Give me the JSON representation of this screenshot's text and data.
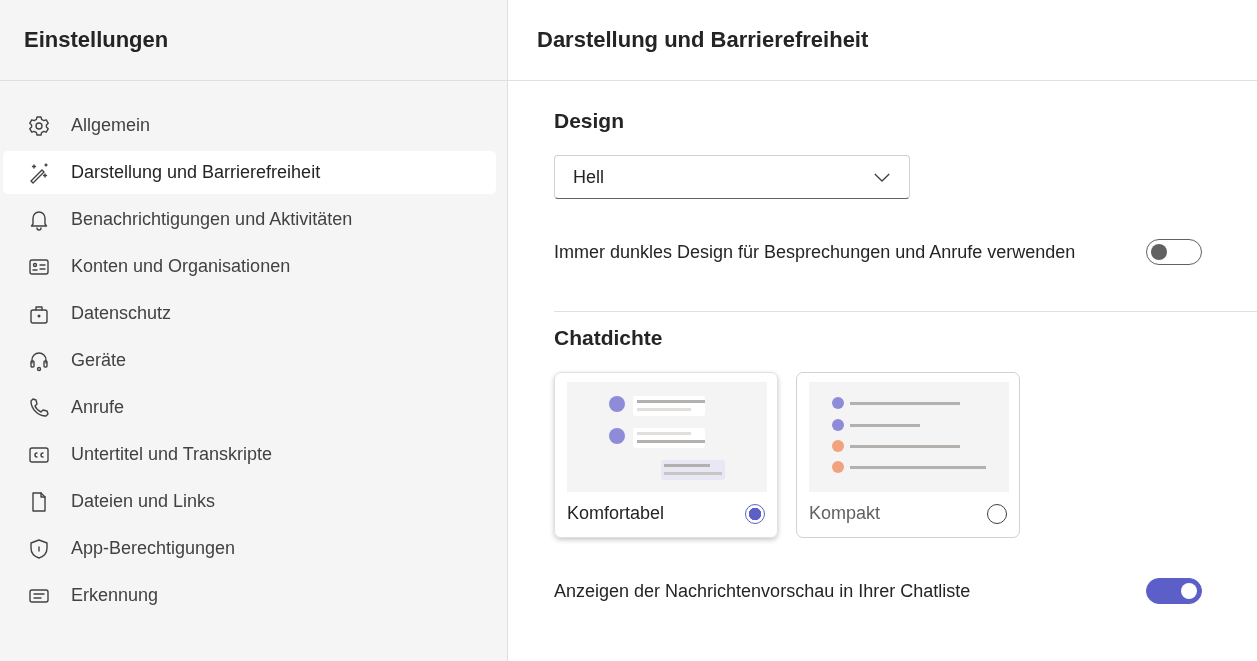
{
  "sidebar": {
    "title": "Einstellungen",
    "items": [
      {
        "label": "Allgemein",
        "selected": false
      },
      {
        "label": "Darstellung und Barrierefreiheit",
        "selected": true
      },
      {
        "label": "Benachrichtigungen und Aktivitäten",
        "selected": false
      },
      {
        "label": "Konten und Organisationen",
        "selected": false
      },
      {
        "label": "Datenschutz",
        "selected": false
      },
      {
        "label": "Geräte",
        "selected": false
      },
      {
        "label": "Anrufe",
        "selected": false
      },
      {
        "label": "Untertitel und Transkripte",
        "selected": false
      },
      {
        "label": "Dateien und Links",
        "selected": false
      },
      {
        "label": "App-Berechtigungen",
        "selected": false
      },
      {
        "label": "Erkennung",
        "selected": false
      }
    ]
  },
  "page": {
    "title": "Darstellung und Barrierefreiheit",
    "design": {
      "heading": "Design",
      "dropdown_value": "Hell",
      "toggle": {
        "label": "Immer dunkles Design für Besprechungen und Anrufe verwenden",
        "on": false
      }
    },
    "chat_density": {
      "heading": "Chatdichte",
      "options": [
        {
          "label": "Komfortabel",
          "kind": "comfortable",
          "selected": true
        },
        {
          "label": "Kompakt",
          "kind": "compact",
          "selected": false
        }
      ],
      "toggle": {
        "label": "Anzeigen der Nachrichtenvorschau in Ihrer Chatliste",
        "on": true
      }
    }
  }
}
